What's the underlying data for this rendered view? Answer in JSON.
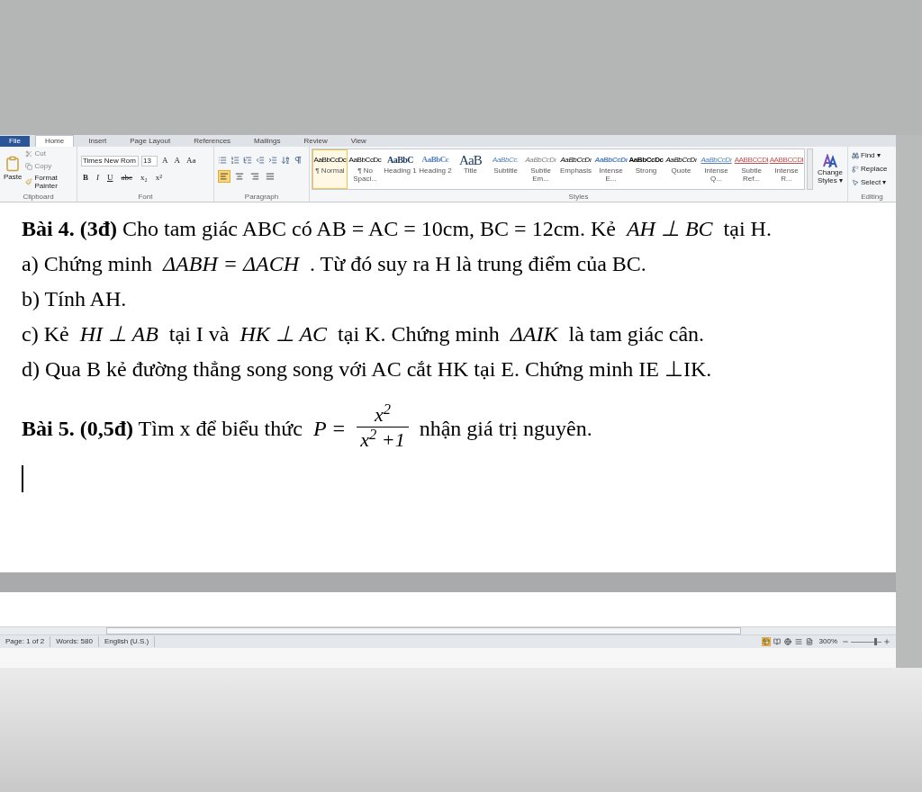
{
  "ribbon": {
    "tabs": [
      {
        "label": "File",
        "selected": false,
        "kind": "file"
      },
      {
        "label": "Home",
        "selected": true,
        "kind": "tab"
      },
      {
        "label": "Insert",
        "selected": false,
        "kind": "tab"
      },
      {
        "label": "Page Layout",
        "selected": false,
        "kind": "tab"
      },
      {
        "label": "References",
        "selected": false,
        "kind": "tab"
      },
      {
        "label": "Mailings",
        "selected": false,
        "kind": "tab"
      },
      {
        "label": "Review",
        "selected": false,
        "kind": "tab"
      },
      {
        "label": "View",
        "selected": false,
        "kind": "tab"
      }
    ],
    "clipboard": {
      "label": "Clipboard",
      "paste": "Paste",
      "cut": "Cut",
      "copy": "Copy",
      "format_painter": "Format Painter"
    },
    "font": {
      "label": "Font",
      "family": "Times New Rom",
      "size": "13",
      "row1": [
        "A",
        "A",
        "Aa"
      ],
      "row2": [
        "B",
        "I",
        "U",
        "abc",
        "x₂",
        "x²"
      ]
    },
    "paragraph": {
      "label": "Paragraph",
      "alignments": [
        {
          "selected": true
        },
        {
          "selected": false
        },
        {
          "selected": false
        },
        {
          "selected": false
        }
      ]
    },
    "styles": {
      "label": "Styles",
      "items": [
        {
          "preview": "AaBbCcDc",
          "name": "¶ Normal",
          "kind": "normal",
          "selected": true
        },
        {
          "preview": "AaBbCcDc",
          "name": "¶ No Spaci...",
          "kind": "normal",
          "selected": false
        },
        {
          "preview": "AaBbC",
          "name": "Heading 1",
          "kind": "heading1",
          "selected": false
        },
        {
          "preview": "AaBbCc",
          "name": "Heading 2",
          "kind": "heading2",
          "selected": false
        },
        {
          "preview": "AaB",
          "name": "Title",
          "kind": "title",
          "selected": false
        },
        {
          "preview": "AaBbCc.",
          "name": "Subtitle",
          "kind": "subtitle",
          "selected": false
        },
        {
          "preview": "AaBbCcDı",
          "name": "Subtle Em...",
          "kind": "subtle",
          "selected": false
        },
        {
          "preview": "AaBbCcDı",
          "name": "Emphasis",
          "kind": "emphasis",
          "selected": false
        },
        {
          "preview": "AaBbCcDı",
          "name": "Intense E...",
          "kind": "intense",
          "selected": false
        },
        {
          "preview": "AaBbCcDc",
          "name": "Strong",
          "kind": "strong",
          "selected": false
        },
        {
          "preview": "AaBbCcDı",
          "name": "Quote",
          "kind": "emphasis",
          "selected": false
        },
        {
          "preview": "AaBbCcDı",
          "name": "Intense Q...",
          "kind": "intensequote",
          "selected": false
        },
        {
          "preview": "AABBCCDI",
          "name": "Subtle Ref...",
          "kind": "reference",
          "selected": false
        },
        {
          "preview": "AABBCCDI",
          "name": "Intense R...",
          "kind": "reference",
          "selected": false
        }
      ],
      "change_styles": "Change Styles ▾"
    },
    "editing": {
      "label": "Editing",
      "find": "Find ▾",
      "replace": "Replace",
      "select": "Select ▾"
    }
  },
  "document": {
    "paragraphs": [
      [
        {
          "kind": "bold",
          "text": "Bài 4. (3đ)"
        },
        {
          "kind": "text",
          "text": " Cho tam giác ABC có AB = AC = 10cm, BC = 12cm. Kẻ "
        },
        {
          "kind": "math",
          "text": "AH ⊥ BC"
        },
        {
          "kind": "text",
          "text": " tại H."
        }
      ],
      [
        {
          "kind": "text",
          "text": "a) Chứng minh "
        },
        {
          "kind": "math",
          "text": "ΔABH = ΔACH"
        },
        {
          "kind": "text",
          "text": " . Từ đó suy ra H là trung điểm của BC."
        }
      ],
      [
        {
          "kind": "text",
          "text": "b) Tính AH."
        }
      ],
      [
        {
          "kind": "text",
          "text": "c) Kẻ "
        },
        {
          "kind": "math",
          "text": "HI ⊥ AB"
        },
        {
          "kind": "text",
          "text": " tại I và "
        },
        {
          "kind": "math",
          "text": "HK ⊥ AC"
        },
        {
          "kind": "text",
          "text": " tại K. Chứng minh "
        },
        {
          "kind": "math",
          "text": "ΔAIK"
        },
        {
          "kind": "text",
          "text": " là tam giác cân."
        }
      ],
      [
        {
          "kind": "text",
          "text": "d) Qua B kẻ đường thẳng song song với AC cắt HK tại E. Chứng minh IE ⊥IK."
        }
      ],
      [
        {
          "kind": "bold",
          "text": "Bài 5. (0,5đ)"
        },
        {
          "kind": "text",
          "text": " Tìm x để biểu thức "
        },
        {
          "kind": "math",
          "text": "P ="
        },
        {
          "kind": "fraction",
          "numerator": "x$^{2}$",
          "denominator": "x$^{2}$ +1"
        },
        {
          "kind": "text",
          "text": " nhận giá trị nguyên."
        }
      ]
    ]
  },
  "status_bar": {
    "page": "Page: 1 of 2",
    "words": "Words: 580",
    "language": "English (U.S.)",
    "views": [
      {
        "selected": true
      },
      {
        "selected": false
      },
      {
        "selected": false
      },
      {
        "selected": false
      },
      {
        "selected": false
      }
    ],
    "zoom": "300%",
    "zoom_slider": {
      "level": 0.85
    }
  }
}
